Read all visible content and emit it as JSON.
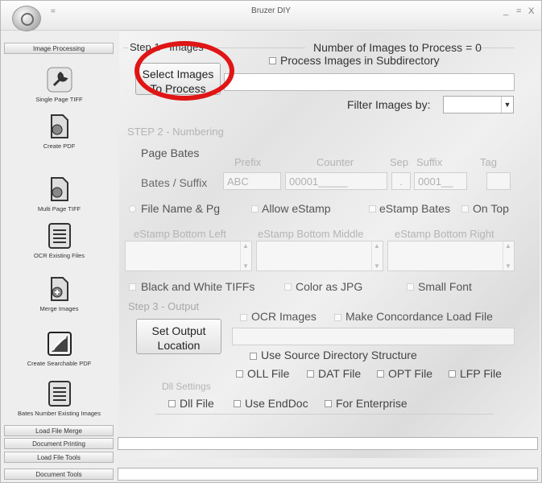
{
  "window": {
    "title": "Bruzer DIY",
    "quick_access": "=",
    "min": "_",
    "max": "=",
    "close": "X"
  },
  "sidebar": {
    "header": "Image Processing",
    "tools": [
      {
        "label": "Single Page TIFF",
        "icon": "wrench-icon"
      },
      {
        "label": "Create PDF",
        "icon": "document-icon"
      },
      {
        "label": "Multi Page TIFF",
        "icon": "document-icon"
      },
      {
        "label": "OCR Existing Files",
        "icon": "document-list-icon"
      },
      {
        "label": "Merge Images",
        "icon": "document-plus-icon"
      },
      {
        "label": "Create Searchable PDF",
        "icon": "pdf-icon"
      },
      {
        "label": "Bates Number Existing Images",
        "icon": "document-list-icon"
      }
    ],
    "bottom_tabs": [
      "Load File Merge",
      "Document Printing",
      "Load File Tools",
      "Document Tools"
    ]
  },
  "step1": {
    "legend": "Step 1 - Images",
    "count_label": "Number of Images to Process = 0",
    "subdir_label": "Process Images in Subdirectory",
    "select_button_line1": "Select Images",
    "select_button_line2": "To Process",
    "path_value": "",
    "filter_label": "Filter Images by:",
    "filter_value": ""
  },
  "step2": {
    "legend": "STEP 2 - Numbering",
    "page_bates": "Page Bates",
    "col_prefix": "Prefix",
    "col_counter": "Counter",
    "col_sep": "Sep",
    "col_suffix": "Suffix",
    "col_tag": "Tag",
    "bates_suffix_label": "Bates / Suffix",
    "prefix_value": "ABC",
    "counter_value": "00001_____",
    "sep_value": ".",
    "suffix_value": "0001__",
    "tag_value": "",
    "filename_pg": "File Name & Pg",
    "allow_estamp": "Allow eStamp",
    "estamp_bates": "eStamp Bates",
    "on_top": "On Top",
    "estamp_left": "eStamp Bottom Left",
    "estamp_middle": "eStamp Bottom Middle",
    "estamp_right": "eStamp Bottom Right",
    "bw_tiffs": "Black and White TIFFs",
    "color_jpg": "Color as JPG",
    "small_font": "Small Font"
  },
  "step3": {
    "legend": "Step 3 - Output",
    "set_output_line1": "Set Output",
    "set_output_line2": "Location",
    "ocr_images": "OCR Images",
    "make_concordance": "Make Concordance Load File",
    "output_path": "",
    "use_source_dir": "Use Source Directory Structure",
    "oll_file": "OLL File",
    "dat_file": "DAT File",
    "opt_file": "OPT File",
    "lfp_file": "LFP File",
    "dll_settings": "Dll Settings",
    "dll_file": "Dll File",
    "use_enddoc": "Use EndDoc",
    "for_enterprise": "For Enterprise"
  }
}
